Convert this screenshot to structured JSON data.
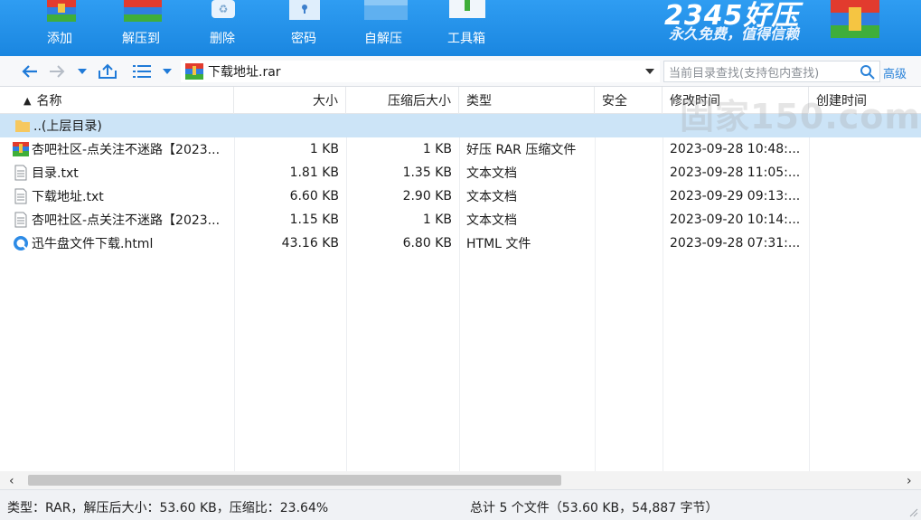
{
  "toolbar": {
    "buttons": [
      {
        "label": "添加",
        "icon": "add-archive-icon"
      },
      {
        "label": "解压到",
        "icon": "extract-to-icon"
      },
      {
        "label": "删除",
        "icon": "delete-icon"
      },
      {
        "label": "密码",
        "icon": "password-icon"
      },
      {
        "label": "自解压",
        "icon": "self-extract-icon"
      },
      {
        "label": "工具箱",
        "icon": "toolbox-icon"
      }
    ],
    "brand_number": "2345",
    "brand_name": "好压",
    "brand_slogan": "永久免费，值得信赖"
  },
  "address": {
    "path": "下载地址.rar",
    "search_placeholder": "当前目录查找(支持包内查找)",
    "advanced_label": "高级"
  },
  "columns": [
    "名称",
    "大小",
    "压缩后大小",
    "类型",
    "安全",
    "修改时间",
    "创建时间"
  ],
  "parent_row": {
    "name": "..(上层目录)"
  },
  "files": [
    {
      "name": "杏吧社区-点关注不迷路【2023...",
      "size": "1 KB",
      "packed": "1 KB",
      "type": "好压 RAR 压缩文件",
      "modified": "2023-09-28 10:48:...",
      "icon": "rar-archive-icon"
    },
    {
      "name": "目录.txt",
      "size": "1.81 KB",
      "packed": "1.35 KB",
      "type": "文本文档",
      "modified": "2023-09-28 11:05:...",
      "icon": "text-file-icon"
    },
    {
      "name": "下载地址.txt",
      "size": "6.60 KB",
      "packed": "2.90 KB",
      "type": "文本文档",
      "modified": "2023-09-29 09:13:...",
      "icon": "text-file-icon"
    },
    {
      "name": "杏吧社区-点关注不迷路【2023...",
      "size": "1.15 KB",
      "packed": "1 KB",
      "type": "文本文档",
      "modified": "2023-09-20 10:14:...",
      "icon": "text-file-icon"
    },
    {
      "name": "迅牛盘文件下载.html",
      "size": "43.16 KB",
      "packed": "6.80 KB",
      "type": "HTML 文件",
      "modified": "2023-09-28 07:31:...",
      "icon": "html-file-icon"
    }
  ],
  "status": {
    "left": "类型：RAR，解压后大小：53.60 KB，压缩比：23.64%",
    "center": "总计 5 个文件（53.60 KB，54,887 字节）"
  },
  "watermark": "固家150.com",
  "colors": {
    "toolbar": "#1a86e0",
    "selected_row": "#cce4f7",
    "accent": "#2b83d9"
  }
}
